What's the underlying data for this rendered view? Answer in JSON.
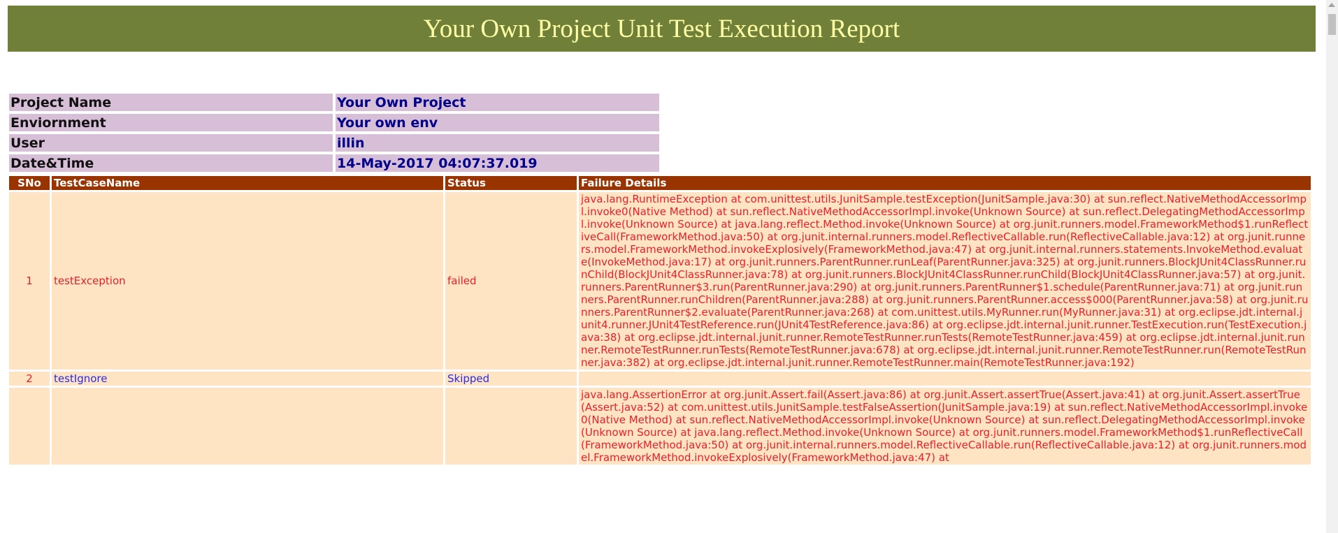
{
  "header": {
    "title": "Your Own Project Unit Test Execution Report"
  },
  "info": [
    {
      "label": "Project Name",
      "value": "Your Own Project"
    },
    {
      "label": "Enviornment",
      "value": "Your own env"
    },
    {
      "label": "User",
      "value": "illin"
    },
    {
      "label": "Date&Time",
      "value": "14-May-2017 04:07:37.019"
    }
  ],
  "results": {
    "columns": [
      "SNo",
      "TestCaseName",
      "Status",
      "Failure Details"
    ],
    "rows": [
      {
        "sno": "1",
        "name": "testException",
        "status": "failed",
        "details": "java.lang.RuntimeException at com.unittest.utils.JunitSample.testException(JunitSample.java:30) at sun.reflect.NativeMethodAccessorImpl.invoke0(Native Method) at sun.reflect.NativeMethodAccessorImpl.invoke(Unknown Source) at sun.reflect.DelegatingMethodAccessorImpl.invoke(Unknown Source) at java.lang.reflect.Method.invoke(Unknown Source) at org.junit.runners.model.FrameworkMethod$1.runReflectiveCall(FrameworkMethod.java:50) at org.junit.internal.runners.model.ReflectiveCallable.run(ReflectiveCallable.java:12) at org.junit.runners.model.FrameworkMethod.invokeExplosively(FrameworkMethod.java:47) at org.junit.internal.runners.statements.InvokeMethod.evaluate(InvokeMethod.java:17) at org.junit.runners.ParentRunner.runLeaf(ParentRunner.java:325) at org.junit.runners.BlockJUnit4ClassRunner.runChild(BlockJUnit4ClassRunner.java:78) at org.junit.runners.BlockJUnit4ClassRunner.runChild(BlockJUnit4ClassRunner.java:57) at org.junit.runners.ParentRunner$3.run(ParentRunner.java:290) at org.junit.runners.ParentRunner$1.schedule(ParentRunner.java:71) at org.junit.runners.ParentRunner.runChildren(ParentRunner.java:288) at org.junit.runners.ParentRunner.access$000(ParentRunner.java:58) at org.junit.runners.ParentRunner$2.evaluate(ParentRunner.java:268) at com.unittest.utils.MyRunner.run(MyRunner.java:31) at org.eclipse.jdt.internal.junit4.runner.JUnit4TestReference.run(JUnit4TestReference.java:86) at org.eclipse.jdt.internal.junit.runner.TestExecution.run(TestExecution.java:38) at org.eclipse.jdt.internal.junit.runner.RemoteTestRunner.runTests(RemoteTestRunner.java:459) at org.eclipse.jdt.internal.junit.runner.RemoteTestRunner.runTests(RemoteTestRunner.java:678) at org.eclipse.jdt.internal.junit.runner.RemoteTestRunner.run(RemoteTestRunner.java:382) at org.eclipse.jdt.internal.junit.runner.RemoteTestRunner.main(RemoteTestRunner.java:192)"
      },
      {
        "sno": "2",
        "name": "testIgnore",
        "status": "Skipped",
        "details": ""
      },
      {
        "sno": "",
        "name": "",
        "status": "",
        "details": "java.lang.AssertionError at org.junit.Assert.fail(Assert.java:86) at org.junit.Assert.assertTrue(Assert.java:41) at org.junit.Assert.assertTrue(Assert.java:52) at com.unittest.utils.JunitSample.testFalseAssertion(JunitSample.java:19) at sun.reflect.NativeMethodAccessorImpl.invoke0(Native Method) at sun.reflect.NativeMethodAccessorImpl.invoke(Unknown Source) at sun.reflect.DelegatingMethodAccessorImpl.invoke(Unknown Source) at java.lang.reflect.Method.invoke(Unknown Source) at org.junit.runners.model.FrameworkMethod$1.runReflectiveCall(FrameworkMethod.java:50) at org.junit.internal.runners.model.ReflectiveCallable.run(ReflectiveCallable.java:12) at org.junit.runners.model.FrameworkMethod.invokeExplosively(FrameworkMethod.java:47) at"
      }
    ]
  }
}
